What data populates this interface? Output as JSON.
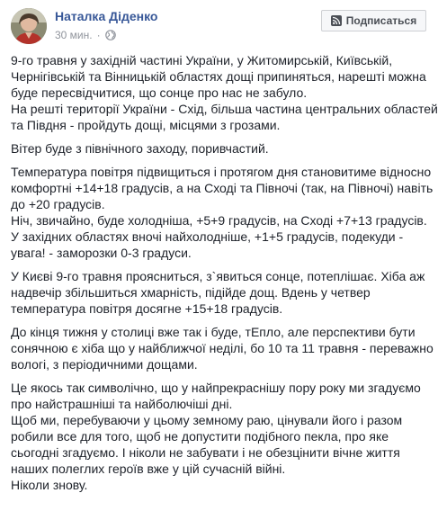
{
  "post": {
    "author": "Наталка Діденко",
    "time": "30 мин.",
    "dot": "·",
    "subscribe_label": "Подписаться"
  },
  "icons": {
    "globe": "globe-icon",
    "subscribe": "rss-icon",
    "avatar": "avatar"
  },
  "paragraphs": [
    [
      "9-го травня у західній частині України, у Житомирській, Київській,",
      "Чернігівській та Вінницькій областях дощі припиняться, нарешті можна",
      "буде пересвідчитися, що сонце про нас не забуло.",
      "На решті території України - Схід, більша частина центральних областей",
      "та Півдня - пройдуть дощі, місцями з грозами."
    ],
    [
      "Вітер буде з північного заходу, поривчастий."
    ],
    [
      "Температура повітря підвищиться і протягом дня становитиме відносно",
      "комфортні +14+18 градусів, а на Сході та Півночі (так, на Півночі) навіть",
      "до +20 градусів.",
      "Ніч, звичайно, буде холодніша, +5+9 градусів, на Сході +7+13 градусів.",
      "У західних областях вночі найхолодніше, +1+5 градусів, подекуди -",
      "увага! - заморозки 0-3 градуси."
    ],
    [
      "У Києві 9-го травня проясниться, з`явиться сонце, потеплішає. Хіба аж",
      "надвечір збільшиться хмарність, підійде дощ. Вдень у четвер",
      "температура повітря досягне +15+18 градусів."
    ],
    [
      "До кінця тижня у столиці вже так і буде, тЕпло, але перспективи бути",
      "сонячною є хіба що у найближчої неділі, бо 10 та 11 травня - переважно",
      "вологі, з періодичними дощами."
    ],
    [
      "Це якось так символічно, що у найпрекраснішу пору року ми згадуємо",
      "про найстрашніші та найболючіші дні.",
      "Щоб ми, перебуваючи у цьому земному раю, цінували його і разом",
      "робили все для того, щоб не допустити подібного пекла, про яке",
      "сьогодні згадуємо. І ніколи не забувати і не обезцінити вічне життя",
      "наших полеглих героїв вже у цій сучасній війні.",
      "Ніколи знову."
    ]
  ]
}
